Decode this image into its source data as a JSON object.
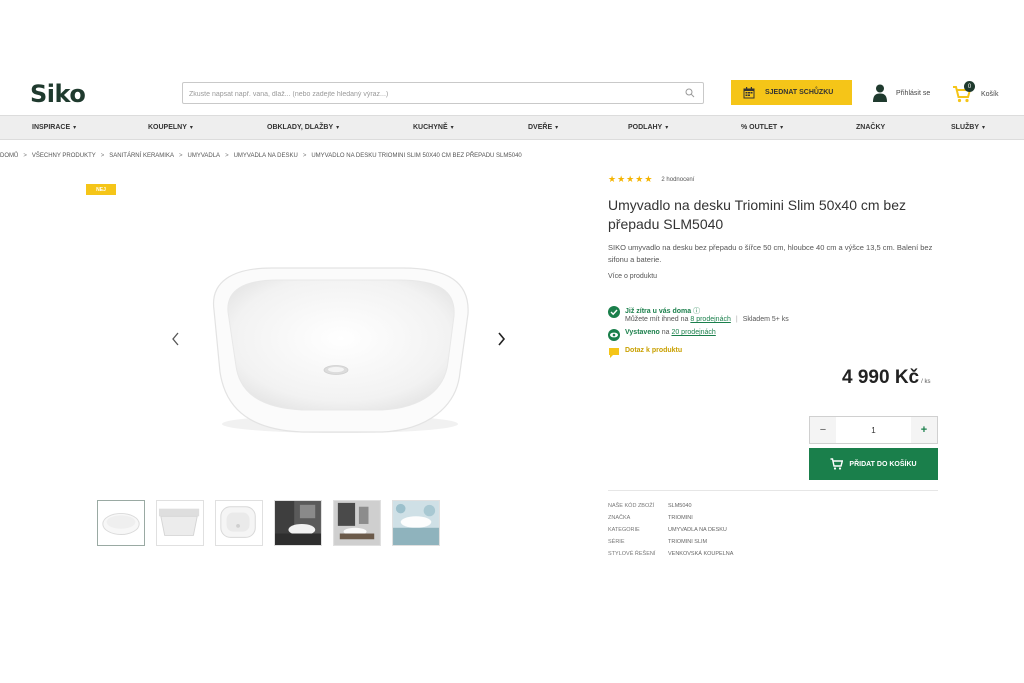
{
  "header": {
    "logo": "Siko",
    "search_placeholder": "Zkuste napsat např. vana, dlaž... (nebo zadejte hledaný výraz...)",
    "appointment_label": "SJEDNAT SCHŮZKU",
    "login_label": "Přihlásit se",
    "cart_label": "Košík",
    "cart_count": "0",
    "accent_color": "#f5c518",
    "brand_color": "#1f3a2e"
  },
  "nav": {
    "items": [
      {
        "label": "INSPIRACE"
      },
      {
        "label": "KOUPELNY"
      },
      {
        "label": "OBKLADY, DLAŽBY"
      },
      {
        "label": "KUCHYNĚ"
      },
      {
        "label": "DVEŘE"
      },
      {
        "label": "PODLAHY"
      },
      {
        "label": "% OUTLET"
      },
      {
        "label": "ZNAČKY"
      },
      {
        "label": "SLUŽBY"
      }
    ]
  },
  "breadcrumb": [
    "DOMŮ",
    "VŠECHNY PRODUKTY",
    "SANITÁRNÍ KERAMIKA",
    "UMYVADLA",
    "UMYVADLA NA DESKU",
    "UMYVADLO NA DESKU TRIOMINI SLIM 50X40 CM BEZ PŘEPADU SLM5040"
  ],
  "gallery": {
    "tag": "NEJ",
    "thumbnail_count": 6,
    "prev_icon": "chevron-left-icon",
    "next_icon": "chevron-right-icon"
  },
  "product": {
    "rating_stars": 5,
    "reviews": "2 hodnocení",
    "title": "Umyvadlo na desku Triomini Slim 50x40 cm bez přepadu SLM5040",
    "description": "SIKO umyvadlo na desku bez přepadu o šířce 50 cm, hloubce 40 cm a výšce 13,5 cm. Balení bez sifonu a baterie.",
    "more_link": "Více o produktu",
    "availability": {
      "tomorrow": "Již zítra u vás doma",
      "pickup_prefix": "Můžete mít ihned na ",
      "pickup_link": "8 prodejnách",
      "stock": "Skladem 5+ ks",
      "exhibited_label": "Vystaveno",
      "exhibited_prefix": " na ",
      "exhibited_link": "20 prodejnách",
      "question": "Dotaz k produktu"
    },
    "price": "4 990 Kč",
    "price_unit": "/ ks",
    "quantity": "1",
    "add_to_cart_label": "PŘIDAT DO KOŠÍKU",
    "cta_color": "#1a7f4b"
  },
  "specs": [
    {
      "key": "NAŠE KÓD ZBOŽÍ",
      "value": "SLM5040"
    },
    {
      "key": "ZNAČKA",
      "value": "TRIOMINI"
    },
    {
      "key": "KATEGORIE",
      "value": "UMYVADLA NA DESKU"
    },
    {
      "key": "SÉRIE",
      "value": "TRIOMINI SLIM"
    },
    {
      "key": "STYLOVÉ ŘEŠENÍ",
      "value": "VENKOVSKÁ KOUPELNA"
    }
  ]
}
